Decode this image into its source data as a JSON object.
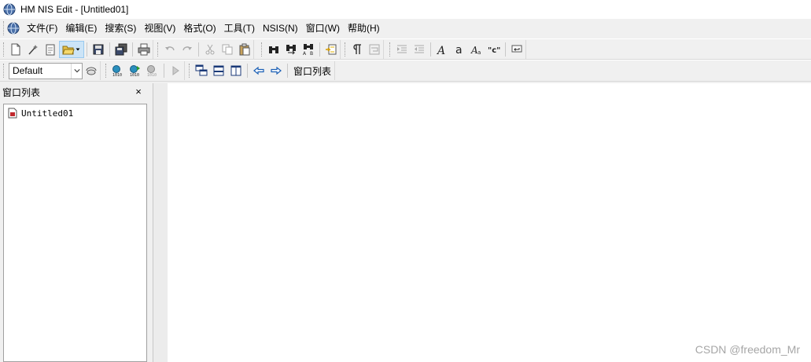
{
  "window": {
    "title": "HM NIS Edit - [Untitled01]"
  },
  "menu": {
    "items": [
      "文件(F)",
      "编辑(E)",
      "搜索(S)",
      "视图(V)",
      "格式(O)",
      "工具(T)",
      "NSIS(N)",
      "窗口(W)",
      "帮助(H)"
    ]
  },
  "toolbar2": {
    "selected_config": "Default",
    "window_list_label": "窗口列表"
  },
  "panel": {
    "title": "窗口列表",
    "close_glyph": "×",
    "files": [
      "Untitled01"
    ]
  },
  "watermark": "CSDN @freedom_Mr",
  "colors": {
    "accent": "#0a64ad",
    "editor_bg": "#ffffff",
    "chrome_bg": "#f0f0f0"
  }
}
